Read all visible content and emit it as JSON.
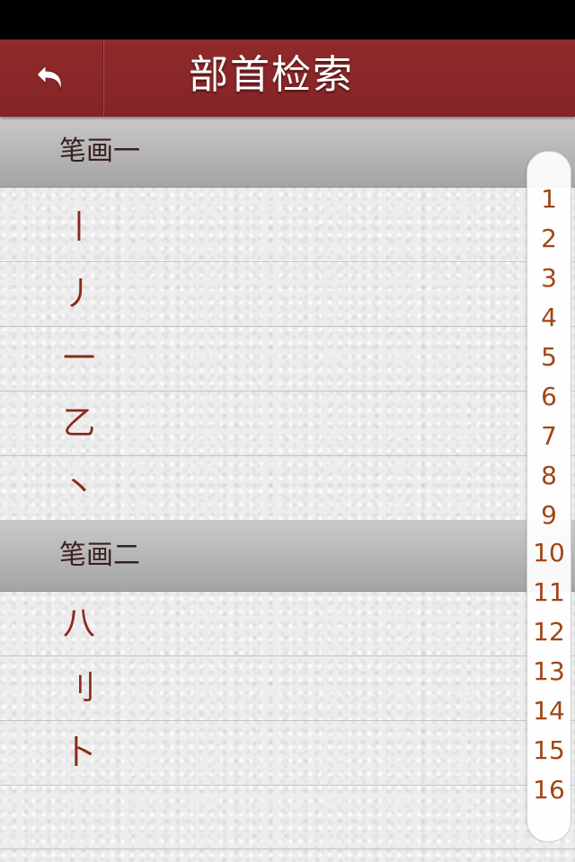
{
  "nav": {
    "title": "部首检索",
    "back_icon": "back-arrow-icon"
  },
  "sections": [
    {
      "header": "笔画一",
      "rows": [
        "丨",
        "丿",
        "一",
        "乙",
        "丶"
      ]
    },
    {
      "header": "笔画二",
      "rows": [
        "八",
        "刂",
        "卜",
        ""
      ]
    }
  ],
  "index": [
    "1",
    "2",
    "3",
    "4",
    "5",
    "6",
    "7",
    "8",
    "9",
    "10",
    "11",
    "12",
    "13",
    "14",
    "15",
    "16"
  ],
  "colors": {
    "nav_bg": "#8b2628",
    "accent_text": "#8a2a1a",
    "index_text": "#a24515"
  }
}
